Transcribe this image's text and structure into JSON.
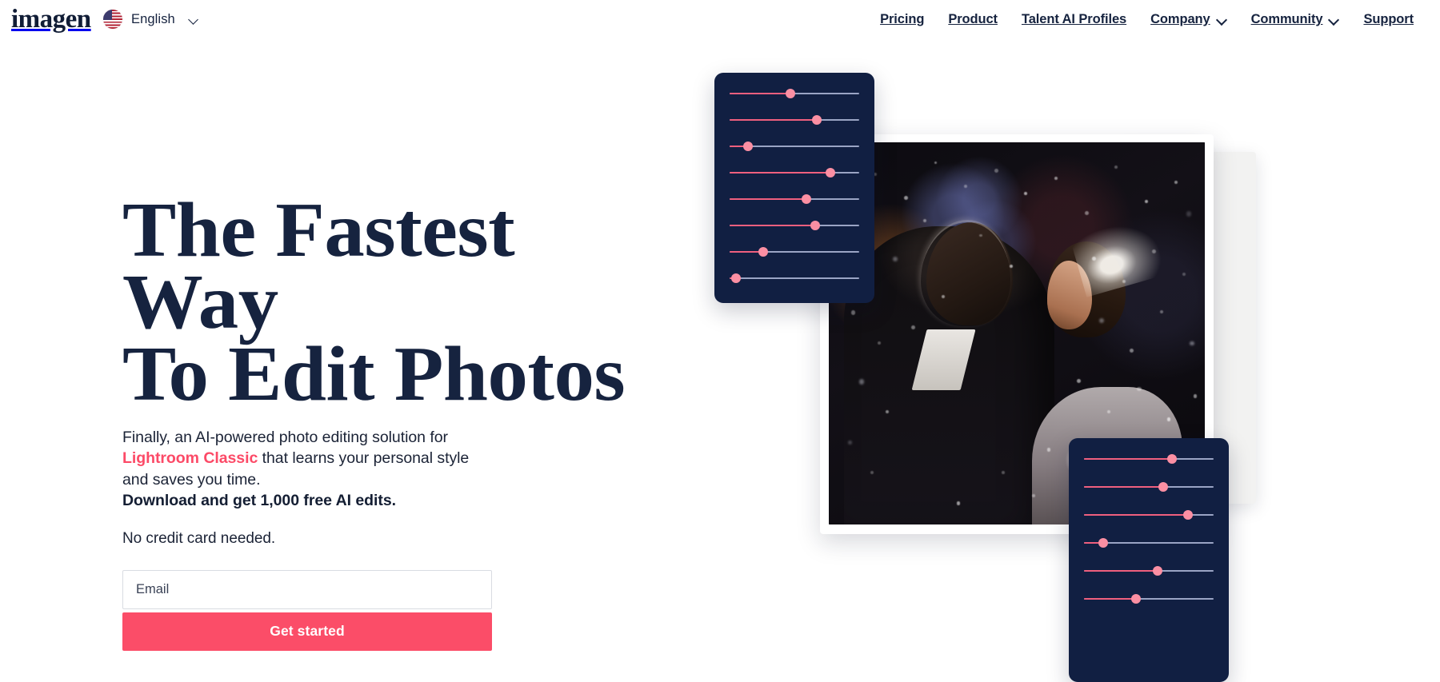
{
  "brand": {
    "wordmark": "imagen",
    "logo_icon": "imagen-logo"
  },
  "header": {
    "language": {
      "label": "English",
      "flag_icon": "us-flag-icon",
      "chevron_icon": "chevron-down-icon"
    },
    "nav": [
      {
        "label": "Pricing",
        "has_dropdown": false
      },
      {
        "label": "Product",
        "has_dropdown": false
      },
      {
        "label": "Talent AI Profiles",
        "has_dropdown": false
      },
      {
        "label": "Company",
        "has_dropdown": true
      },
      {
        "label": "Community",
        "has_dropdown": true
      },
      {
        "label": "Support",
        "has_dropdown": false
      }
    ]
  },
  "hero": {
    "headline": "The Fastest Way\nTo Edit Photos",
    "subcopy_part1": "Finally, an AI-powered photo editing solution for ",
    "subcopy_accent": "Lightroom Classic",
    "subcopy_part2": " that learns your personal style and saves you time.",
    "subcopy_bold": "Download and get 1,000 free AI edits.",
    "no_credit_card": "No credit card needed.",
    "form": {
      "email_placeholder": "Email",
      "email_value": "",
      "cta_label": "Get started"
    }
  },
  "colors": {
    "accent_pink": "#fc4a67",
    "cta_pink": "#fb4d68",
    "navy": "#16233f",
    "panel_navy": "#111f42",
    "slider_fill": "#ef5f7e",
    "slider_thumb": "#fb8fa3",
    "slider_track": "#9aa4c4"
  },
  "visual": {
    "photo_alt": "wedding-couple-photo",
    "panel_top": {
      "name": "editing-sliders-panel-top",
      "sliders": [
        {
          "name": "slider-1",
          "value": 47
        },
        {
          "name": "slider-2",
          "value": 67
        },
        {
          "name": "slider-3",
          "value": 14
        },
        {
          "name": "slider-4",
          "value": 78
        },
        {
          "name": "slider-5",
          "value": 59
        },
        {
          "name": "slider-6",
          "value": 66
        },
        {
          "name": "slider-7",
          "value": 26
        },
        {
          "name": "slider-8",
          "value": 5
        }
      ]
    },
    "panel_bottom": {
      "name": "editing-sliders-panel-bottom",
      "sliders": [
        {
          "name": "slider-1",
          "value": 68
        },
        {
          "name": "slider-2",
          "value": 61
        },
        {
          "name": "slider-3",
          "value": 80
        },
        {
          "name": "slider-4",
          "value": 15
        },
        {
          "name": "slider-5",
          "value": 57
        },
        {
          "name": "slider-6",
          "value": 40
        }
      ]
    }
  }
}
